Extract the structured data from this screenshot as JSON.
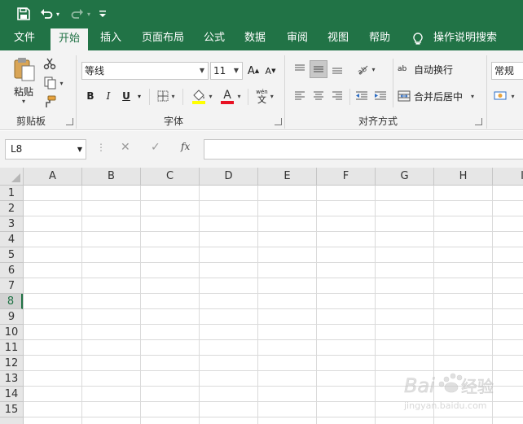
{
  "quick_access": {
    "icons": [
      "save-icon",
      "undo-icon",
      "redo-icon",
      "customize-icon"
    ]
  },
  "tabs": [
    {
      "label": "文件",
      "active": false
    },
    {
      "label": "开始",
      "active": true
    },
    {
      "label": "插入",
      "active": false
    },
    {
      "label": "页面布局",
      "active": false
    },
    {
      "label": "公式",
      "active": false
    },
    {
      "label": "数据",
      "active": false
    },
    {
      "label": "审阅",
      "active": false
    },
    {
      "label": "视图",
      "active": false
    },
    {
      "label": "帮助",
      "active": false
    }
  ],
  "tell_me": "操作说明搜索",
  "ribbon": {
    "clipboard": {
      "paste_label": "粘贴",
      "group_label": "剪贴板"
    },
    "font": {
      "font_name": "等线",
      "font_size": "11",
      "bold": "B",
      "italic": "I",
      "underline": "U",
      "increase_font": "A",
      "decrease_font": "A",
      "font_color_letter": "A",
      "phonetic_top": "wén",
      "phonetic_bottom": "文",
      "group_label": "字体"
    },
    "alignment": {
      "wrap_text": "自动换行",
      "merge_center": "合并后居中",
      "wrap_icon_text": "ab",
      "group_label": "对齐方式"
    },
    "number": {
      "format": "常规"
    }
  },
  "formula_bar": {
    "name_box": "L8",
    "fx_label": "fx",
    "formula": ""
  },
  "sheet": {
    "columns": [
      "A",
      "B",
      "C",
      "D",
      "E",
      "F",
      "G",
      "H",
      "I"
    ],
    "rows": [
      "1",
      "2",
      "3",
      "4",
      "5",
      "6",
      "7",
      "8",
      "9",
      "10",
      "11",
      "12",
      "13",
      "14",
      "15"
    ],
    "selected_row": "8"
  },
  "watermark": {
    "brand": "Bai",
    "brand_cn": "经验",
    "url": "jingyan.baidu.com"
  },
  "colors": {
    "accent": "#217346",
    "ribbon_bg": "#f3f3f3",
    "header_bg": "#e6e6e6",
    "gridline": "#dadada",
    "font_color_bar": "#e81123",
    "highlight_bar": "#ffff00"
  }
}
